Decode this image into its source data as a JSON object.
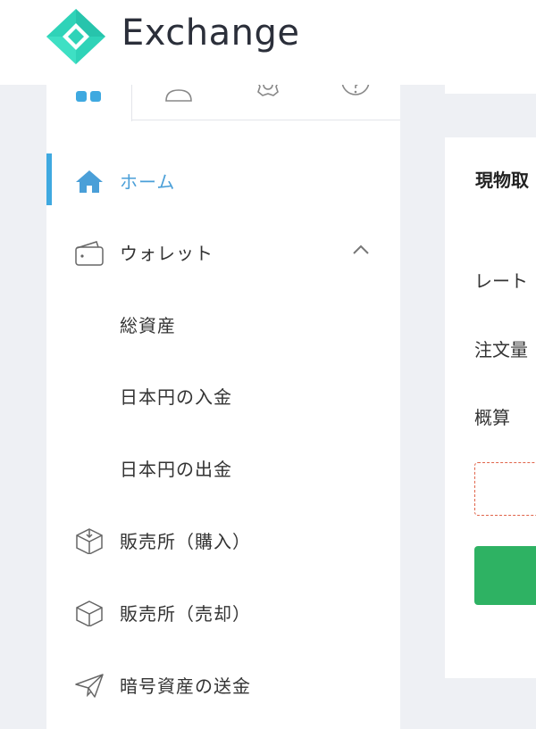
{
  "header": {
    "brand": "Exchange"
  },
  "sidebar": {
    "tabs": [
      {
        "icon": "dashboard-icon",
        "active": true
      },
      {
        "icon": "user-icon",
        "active": false
      },
      {
        "icon": "gear-icon",
        "active": false
      },
      {
        "icon": "help-icon",
        "active": false
      }
    ],
    "items": [
      {
        "label": "ホーム",
        "icon": "home-icon",
        "active": true
      },
      {
        "label": "ウォレット",
        "icon": "wallet-icon",
        "expanded": true
      },
      {
        "label": "総資産"
      },
      {
        "label": "日本円の入金"
      },
      {
        "label": "日本円の出金"
      },
      {
        "label": "販売所（購入）",
        "icon": "box-download-icon"
      },
      {
        "label": "販売所（売却）",
        "icon": "box-icon"
      },
      {
        "label": "暗号資産の送金",
        "icon": "paper-plane-icon"
      }
    ]
  },
  "main": {
    "title": "現物取",
    "rows": [
      "レート",
      "注文量",
      "概算"
    ]
  },
  "colors": {
    "accent": "#3fa9e0",
    "brand_teal": "#2fd3b8",
    "submit": "#2eb263",
    "warning_border": "#e0644a"
  }
}
